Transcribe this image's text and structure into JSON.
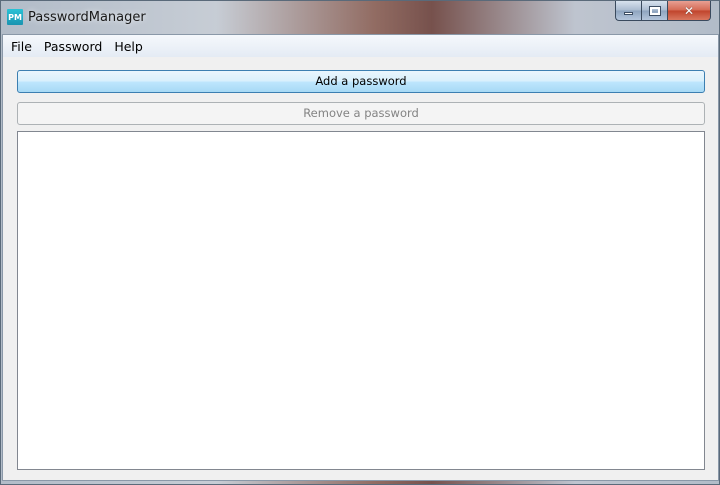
{
  "window": {
    "title": "PasswordManager",
    "icon_text": "PM",
    "icon_color": "#29c2d6"
  },
  "caption": {
    "minimize_glyph": "minimize-icon",
    "maximize_glyph": "maximize-icon",
    "close_glyph": "✕"
  },
  "menu": {
    "items": [
      {
        "label": "File"
      },
      {
        "label": "Password"
      },
      {
        "label": "Help"
      }
    ]
  },
  "buttons": {
    "add_label": "Add a password",
    "remove_label": "Remove a password",
    "remove_enabled": false
  },
  "list": {
    "items": []
  }
}
